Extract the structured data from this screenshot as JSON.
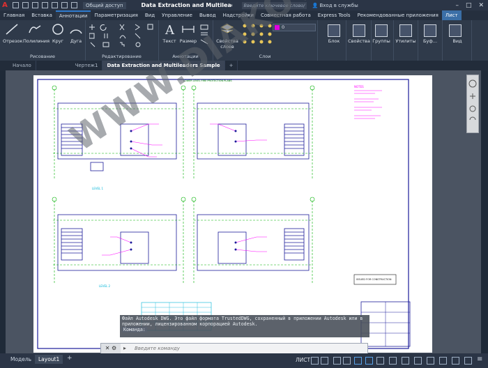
{
  "titlebar": {
    "logo_letter": "A",
    "share_label": "Общий доступ",
    "doc_title": "Data Extraction and Multileaders Sa...",
    "search_placeholder": "Введите ключевое слово/фразу",
    "login_label": "Вход в службы"
  },
  "ribbon_tabs": [
    "Главная",
    "Вставка",
    "Аннотации",
    "Параметризация",
    "Вид",
    "Управление",
    "Вывод",
    "Надстройки",
    "Совместная работа",
    "Express Tools",
    "Рекомендованные приложения",
    "Лист"
  ],
  "ribbon": {
    "draw": {
      "tools": [
        "Отрезок",
        "Полилиния",
        "Круг",
        "Дуга"
      ],
      "label": "Рисование"
    },
    "modify_label": "Редактирование",
    "annotations": {
      "tools": [
        "Текст",
        "Размер"
      ],
      "label": "Аннотации"
    },
    "layers": {
      "props_label": "Свойства слоев",
      "current_layer": "0",
      "label": "Слои"
    },
    "right_tools": [
      "Блок",
      "Свойства",
      "Группы",
      "Утилиты",
      "Буф...",
      "Вид"
    ]
  },
  "file_tabs": [
    "Начало",
    "Чертеж1",
    "Data Extraction and Multileaders Sample"
  ],
  "drawing": {
    "title_text": "LOWER LEVEL FIRE PROTECTION PLANS",
    "notes_title": "NOTES",
    "level1_label": "LEVEL 1",
    "level2_label": "LEVEL 2",
    "stamp_text": "ISSUED FOR CONSTRUCTION"
  },
  "command": {
    "history_line1": "Файл Autodesk DWG. Это файл формата TrustedDWG, сохраненный в приложении Autodesk или в",
    "history_line2": "приложении, лицензированном корпорацией Autodesk.",
    "prompt_label": "Команда:",
    "placeholder": "Введите команду"
  },
  "status": {
    "layout_tabs": [
      "Модель",
      "Layout1"
    ],
    "space_label": "ЛИСТ"
  },
  "watermark": "WWW.DIAKOV.NET",
  "colors": {
    "accent": "#2e7bcf",
    "drawing_blue": "#0000cc",
    "drawing_magenta": "#ff00ff",
    "drawing_green": "#00b000",
    "drawing_cyan": "#00b4d8"
  }
}
